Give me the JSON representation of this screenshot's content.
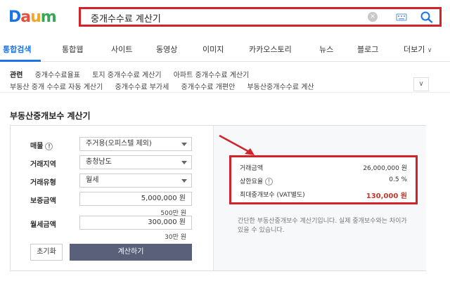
{
  "logo": {
    "d": "D",
    "a": "a",
    "u": "u",
    "m": "m",
    "d_color": "#1a73e8",
    "a_color": "#e84d3d",
    "u_color": "#f5a623",
    "m_color": "#35a853"
  },
  "search": {
    "query": "중개수수료 계산기",
    "clear": "×"
  },
  "tabs": [
    "통합검색",
    "통합웹",
    "사이트",
    "동영상",
    "이미지",
    "카카오스토리",
    "뉴스",
    "블로그",
    "더보기"
  ],
  "related": {
    "head": "관련",
    "row1": [
      "중개수수료율표",
      "토지 중개수수료 계산기",
      "아파트 중개수수료 계산기"
    ],
    "row2": [
      "부동산 중개 수수료 자동 계산기",
      "중개수수료 부가세",
      "중개수수료 개편안",
      "부동산중개수수료 계산"
    ]
  },
  "calculator": {
    "title": "부동산중개보수 계산기",
    "fields": {
      "property": {
        "label": "매물",
        "value": "주거용(오피스텔 제외)"
      },
      "region": {
        "label": "거래지역",
        "value": "충청남도"
      },
      "type": {
        "label": "거래유형",
        "value": "월세"
      },
      "deposit": {
        "label": "보증금액",
        "value": "5,000,000 원",
        "sub": "500만 원"
      },
      "monthly": {
        "label": "월세금액",
        "value": "300,000 원",
        "sub": "30만 원"
      }
    },
    "reset_label": "초기화",
    "calc_label": "계산하기",
    "results": {
      "amount_label": "거래금액",
      "amount_value": "26,000,000 원",
      "rate_label": "상한요율",
      "rate_value": "0.5 %",
      "max_label": "최대중개보수 (VAT별도)",
      "max_value": "130,000 원"
    },
    "description": "간단한 부동산중개보수 계산기입니다. 실제 중개보수와는 차이가 있을 수 있습니다."
  },
  "colors": {
    "accent": "#1a73e8",
    "highlight": "#d2232a",
    "button": "#5a6079"
  }
}
